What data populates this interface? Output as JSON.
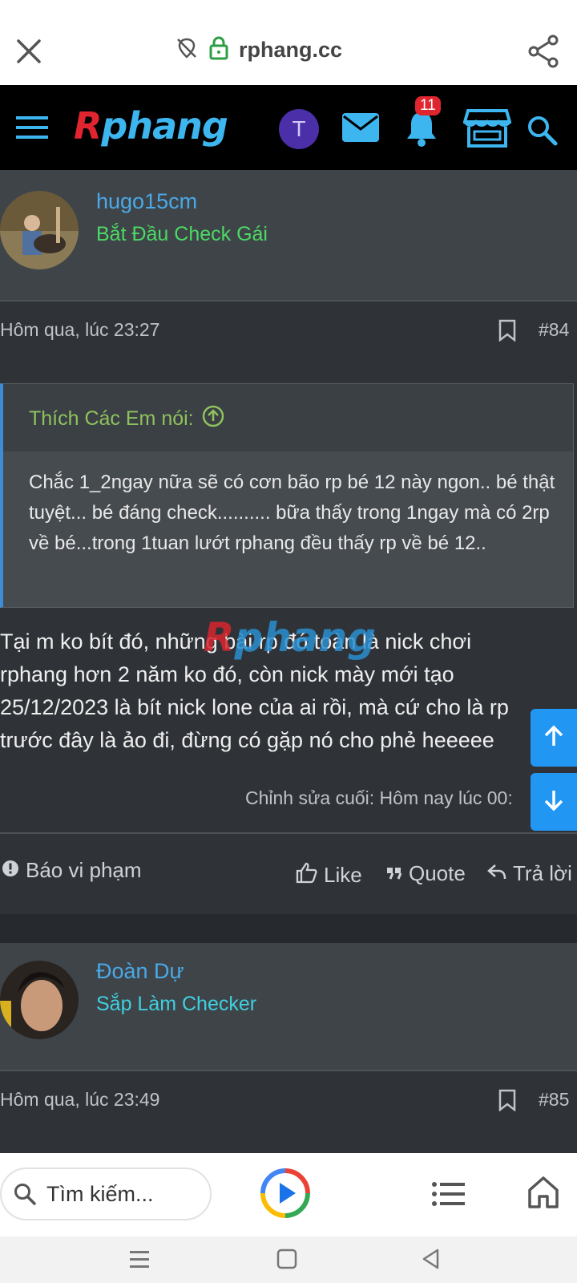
{
  "browser": {
    "url": "rphang.cc",
    "close_icon": "close-icon",
    "share_icon": "share-icon"
  },
  "site": {
    "logo_r": "R",
    "logo_rest": "phang",
    "avatar_letter": "T",
    "notification_count": "11"
  },
  "post84": {
    "username": "hugo15cm",
    "user_title": "Bắt Đầu Check Gái",
    "date": "Hôm qua, lúc 23:27",
    "number": "#84",
    "quote_author": "Thích Các Em nói:",
    "quote_text": "Chắc 1_2ngay nữa sẽ có cơn bão rp bé 12 này ngon.. bé thật tuyệt... bé đáng check.......... bữa thấy trong 1ngay mà có 2rp về bé...trong 1tuan lướt rphang đều thấy rp về bé 12..",
    "body": "Tại m ko bít đó, những bài rp đó toàn là nick chơi\nrphang hơn 2 năm ko đó, còn nick mày mới tạo\n25/12/2023 là bít nick lone của ai rồi, mà cứ cho là rp\ntrước đây là ảo đi, đừng có gặp nó cho phẻ heeeee",
    "edited": "Chỉnh sửa cuối: Hôm nay lúc 00:",
    "report": "Báo vi phạm",
    "like": "Like",
    "quote": "Quote",
    "reply": "Trả lời"
  },
  "post85": {
    "username": "Đoàn Dự",
    "user_title": "Sắp Làm Checker",
    "date": "Hôm qua, lúc 23:49",
    "number": "#85"
  },
  "bottom": {
    "search_placeholder": "Tìm kiếm..."
  },
  "colors": {
    "accent": "#2196f3",
    "username": "#4aa9e8",
    "title_green": "#4cd964",
    "title_cyan": "#3fd0e0",
    "quote_author": "#8fc25d"
  }
}
